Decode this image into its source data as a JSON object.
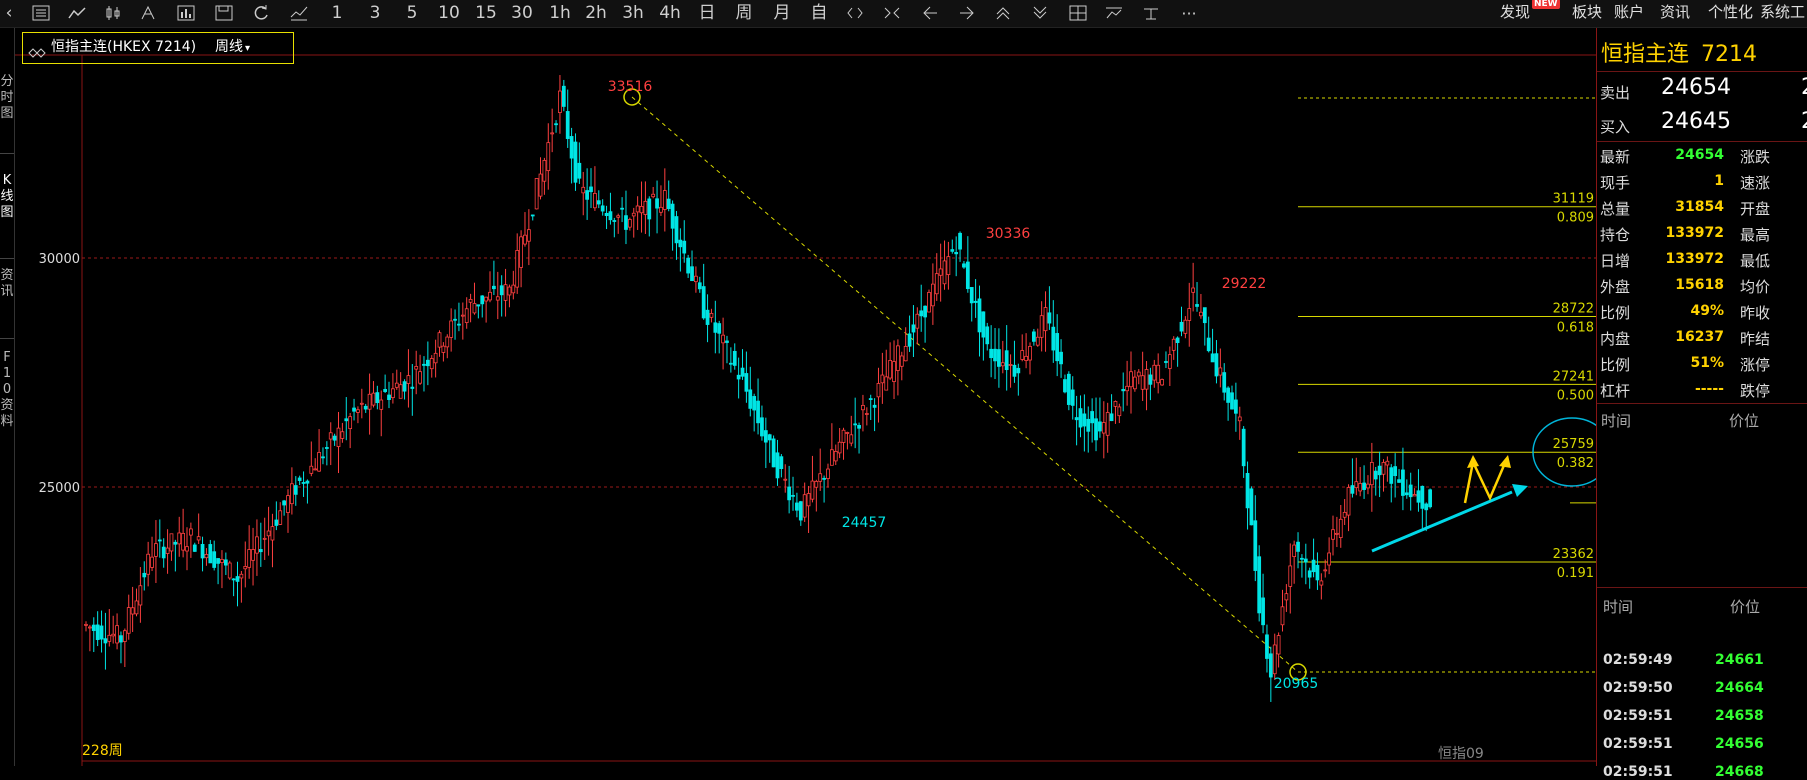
{
  "toolbar": {
    "periods": [
      "1",
      "3",
      "5",
      "10",
      "15",
      "30",
      "1h",
      "2h",
      "3h",
      "4h",
      "日",
      "周",
      "月",
      "自"
    ],
    "right_menu": [
      "发现",
      "板块",
      "账户",
      "资讯",
      "个性化",
      "系统工"
    ],
    "new_badge": "NEW"
  },
  "left_tabs": [
    "分时图",
    "K线图",
    "资讯",
    "F10资料"
  ],
  "chart": {
    "title": "恒指主连(HKEX 7214)",
    "period_label": "周线",
    "y_ticks": [
      "30000",
      "25000"
    ],
    "x_label": "228周",
    "watermark": "恒指09",
    "annotations": {
      "high": "33516",
      "mid_high": "30336",
      "right_high": "29222",
      "low1": "24457",
      "low2": "20965"
    },
    "fib_levels": [
      {
        "price": "31119",
        "ratio": "0.809"
      },
      {
        "price": "28722",
        "ratio": "0.618"
      },
      {
        "price": "27241",
        "ratio": "0.500"
      },
      {
        "price": "25759",
        "ratio": "0.382"
      },
      {
        "price": "23362",
        "ratio": "0.191"
      }
    ]
  },
  "chart_data": {
    "type": "candlestick",
    "instrument": "恒指主连(HKEX 7214)",
    "period": "周线",
    "y_ticks": [
      30000,
      25000
    ],
    "swing_points": [
      {
        "label": "high",
        "value": 33516
      },
      {
        "label": "low",
        "value": 24457
      },
      {
        "label": "high",
        "value": 30336
      },
      {
        "label": "high",
        "value": 29222
      },
      {
        "label": "low",
        "value": 20965
      }
    ],
    "fibonacci": [
      {
        "ratio": 0.809,
        "price": 31119
      },
      {
        "ratio": 0.618,
        "price": 28722
      },
      {
        "ratio": 0.5,
        "price": 27241
      },
      {
        "ratio": 0.382,
        "price": 25759
      },
      {
        "ratio": 0.191,
        "price": 23362
      }
    ],
    "colors": {
      "up": "#ff4040",
      "down": "#00e5e5",
      "fib": "#d8d800",
      "annot_high": "#ff4040",
      "annot_low": "#00e5e5"
    }
  },
  "panel": {
    "title": "恒指主连",
    "code": "7214",
    "ask_label": "卖出",
    "ask": "24654",
    "ask_extra": "2",
    "bid_label": "买入",
    "bid": "24645",
    "bid_extra": "2",
    "quote_rows": [
      {
        "label": "最新",
        "value": "24654",
        "color": "#33ff33",
        "label2": "涨跌"
      },
      {
        "label": "现手",
        "value": "1",
        "color": "#ffd200",
        "label2": "速涨"
      },
      {
        "label": "总量",
        "value": "31854",
        "color": "#ffd200",
        "label2": "开盘"
      },
      {
        "label": "持仓",
        "value": "133972",
        "color": "#ffd200",
        "label2": "最高"
      },
      {
        "label": "日增",
        "value": "133972",
        "color": "#ffd200",
        "label2": "最低"
      },
      {
        "label": "外盘",
        "value": "15618",
        "color": "#ffd200",
        "label2": "均价"
      },
      {
        "label": "比例",
        "value": "49%",
        "color": "#ffd200",
        "label2": "昨收"
      },
      {
        "label": "内盘",
        "value": "16237",
        "color": "#ffd200",
        "label2": "昨结"
      },
      {
        "label": "比例",
        "value": "51%",
        "color": "#ffd200",
        "label2": "涨停"
      },
      {
        "label": "杠杆",
        "value": "-----",
        "color": "#ffd200",
        "label2": "跌停"
      }
    ],
    "time_header": "时间",
    "price_header": "价位",
    "ticks": [
      {
        "time": "02:59:49",
        "price": "24661"
      },
      {
        "time": "02:59:50",
        "price": "24664"
      },
      {
        "time": "02:59:51",
        "price": "24658"
      },
      {
        "time": "02:59:51",
        "price": "24656"
      },
      {
        "time": "02:59:51",
        "price": "24668"
      }
    ]
  }
}
